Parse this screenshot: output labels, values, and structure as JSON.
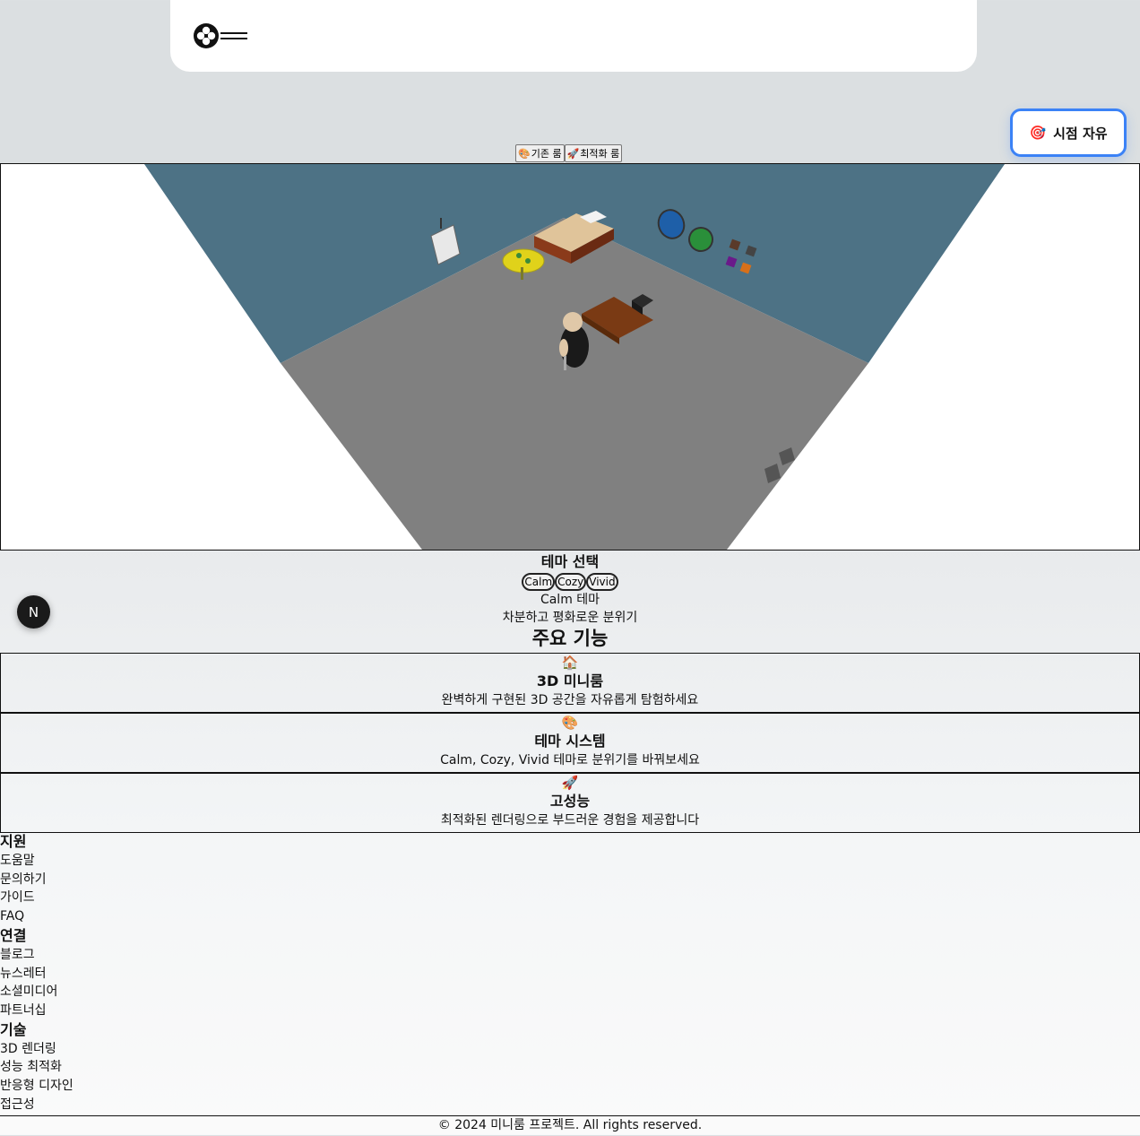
{
  "header": {
    "logo_icon": "quad-circle-logo-icon",
    "menu_icon": "hamburger-menu-icon"
  },
  "view_button": {
    "icon": "🎯",
    "label": "시점 자유"
  },
  "room_toggle": [
    {
      "icon": "🎨",
      "label": "기존 룸"
    },
    {
      "icon": "🚀",
      "label": "최적화 룸"
    }
  ],
  "scene": {
    "wall_color": "#4d7285",
    "floor_color": "#808080"
  },
  "theme": {
    "title": "테마 선택",
    "options": [
      "Calm",
      "Cozy",
      "Vivid"
    ],
    "current_name": "Calm 테마",
    "current_desc": "차분하고 평화로운 분위기"
  },
  "badge": {
    "label": "N"
  },
  "features": {
    "title": "주요 기능",
    "items": [
      {
        "icon": "🏠",
        "title": "3D 미니룸",
        "desc": "완벽하게 구현된 3D 공간을 자유롭게 탐험하세요"
      },
      {
        "icon": "🎨",
        "title": "테마 시스템",
        "desc": "Calm, Cozy, Vivid 테마로 분위기를 바꿔보세요"
      },
      {
        "icon": "🚀",
        "title": "고성능",
        "desc": "최적화된 렌더링으로 부드러운 경험을 제공합니다"
      }
    ]
  },
  "footer": {
    "columns": [
      {
        "title": "지원",
        "links": [
          "도움말",
          "문의하기",
          "가이드",
          "FAQ"
        ]
      },
      {
        "title": "연결",
        "links": [
          "블로그",
          "뉴스레터",
          "소셜미디어",
          "파트너십"
        ]
      },
      {
        "title": "기술",
        "links": [
          "3D 렌더링",
          "성능 최적화",
          "반응형 디자인",
          "접근성"
        ]
      }
    ],
    "copyright": "© 2024 미니룸 프로젝트. All rights reserved."
  }
}
